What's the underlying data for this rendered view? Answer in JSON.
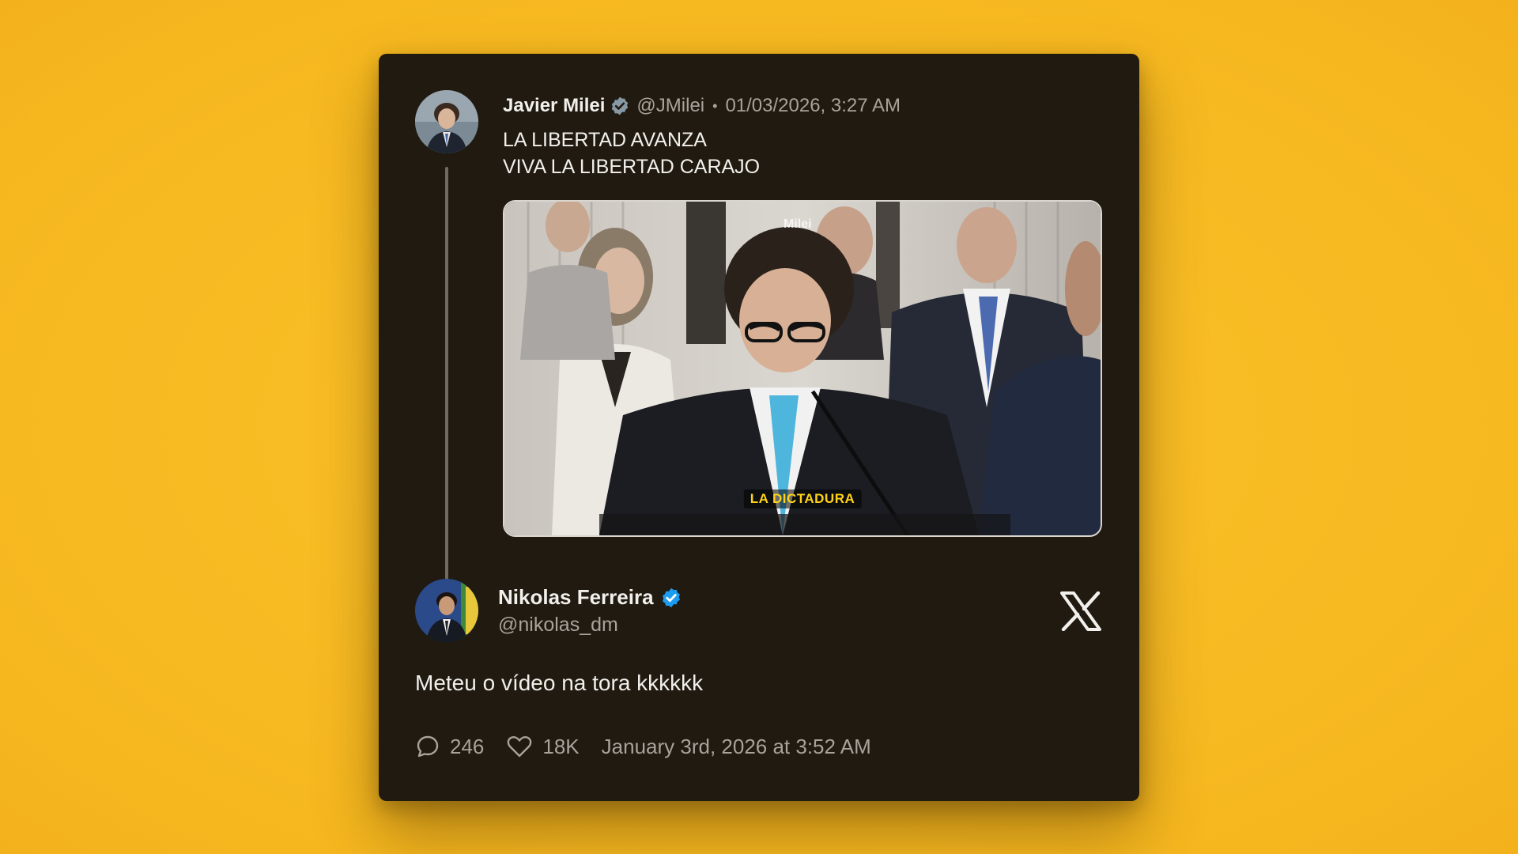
{
  "quoted": {
    "name": "Javier Milei",
    "handle": "@JMilei",
    "separator": "•",
    "timestamp": "01/03/2026, 3:27 AM",
    "text_lines": [
      "LA LIBERTAD AVANZA",
      "VIVA LA LIBERTAD CARAJO"
    ],
    "media": {
      "caption": "LA DICTADURA",
      "watermark": "Milei"
    },
    "verified_color": "#8899a6"
  },
  "tweet": {
    "name": "Nikolas Ferreira",
    "handle": "@nikolas_dm",
    "text": "Meteu o vídeo na tora kkkkkk",
    "replies": "246",
    "likes": "18K",
    "date": "January 3rd, 2026 at 3:52 AM",
    "verified_color": "#1d9bf0"
  },
  "colors": {
    "background": "#f9bd26",
    "card": "#201a10",
    "text": "#f2f0ec",
    "muted": "#a8a39b"
  },
  "icons": {
    "reply": "speech-bubble-icon",
    "like": "heart-icon",
    "brand": "x-logo-icon",
    "verified": "verified-badge-icon"
  }
}
